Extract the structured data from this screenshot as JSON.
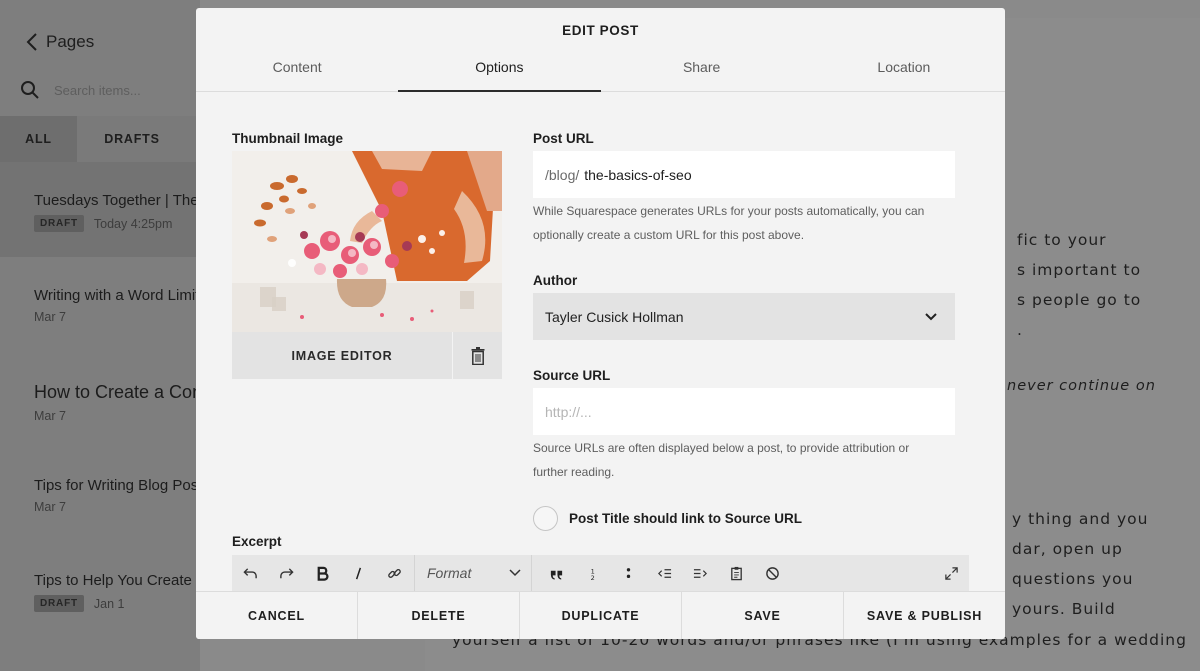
{
  "background": {
    "back_label": "Pages",
    "search_placeholder": "Search items...",
    "filters": [
      "ALL",
      "DRAFTS"
    ],
    "items": [
      {
        "title": "Tuesdays Together | The",
        "badge": "DRAFT",
        "date": "Today 4:25pm"
      },
      {
        "title": "Writing with a Word Limit",
        "date": "Mar 7"
      },
      {
        "title": "How to Create a Con",
        "date": "Mar 7"
      },
      {
        "title": "Tips for Writing Blog Posts",
        "date": "Mar 7"
      },
      {
        "title": "Tips to Help You Create a",
        "badge": "DRAFT",
        "date": "Jan 1"
      }
    ],
    "article_lines": [
      "fic to your",
      "s important to",
      "s people go to",
      ".",
      "never continue on",
      "y thing and you",
      "dar, open up",
      "questions you",
      "yours. Build",
      "yourself a list of 10-20 words and/or phrases like (I'm using examples for a wedding"
    ]
  },
  "modal": {
    "title": "EDIT POST",
    "tabs": [
      "Content",
      "Options",
      "Share",
      "Location"
    ],
    "active_tab": "Options",
    "thumbnail": {
      "label": "Thumbnail Image",
      "image_editor_label": "IMAGE EDITOR",
      "trash_icon": "trash-icon"
    },
    "post_url": {
      "label": "Post URL",
      "prefix": "/blog/",
      "value": "the-basics-of-seo",
      "help_line1": "While Squarespace generates URLs for your posts automatically, you can",
      "help_line2": "optionally create a custom URL for this post above."
    },
    "author": {
      "label": "Author",
      "value": "Tayler Cusick Hollman"
    },
    "source_url": {
      "label": "Source URL",
      "placeholder": "http://...",
      "help_line1": "Source URLs are often displayed below a post, to provide attribution or",
      "help_line2": "further reading."
    },
    "title_link_option": "Post Title should link to Source URL",
    "excerpt": {
      "label": "Excerpt",
      "format_placeholder": "Format",
      "toolbar_icons": [
        "undo-icon",
        "redo-icon",
        "bold-icon",
        "italic-icon",
        "link-icon",
        "format-select",
        "blockquote-icon",
        "numbered-list-icon",
        "bulleted-list-icon",
        "outdent-icon",
        "indent-icon",
        "paste-icon",
        "clear-format-icon",
        "expand-icon"
      ]
    },
    "footer": {
      "cancel": "CANCEL",
      "delete": "DELETE",
      "duplicate": "DUPLICATE",
      "save": "SAVE",
      "save_publish": "SAVE & PUBLISH"
    }
  },
  "colors": {
    "modal_bg": "#f3f3f3",
    "overlay_bg": "#8a8a8a",
    "field_bg": "#ffffff",
    "select_bg": "#e3e3e3"
  }
}
